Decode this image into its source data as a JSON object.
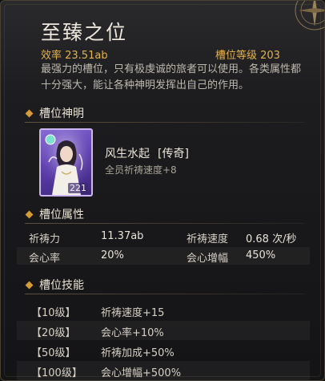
{
  "slot": {
    "title": "至臻之位",
    "efficiency": "效率 23.51ab",
    "level": "槽位等级 203",
    "description": "最强力的槽位，只有极虔诚的旅者可以使用。各类属性都十分强大，能让各种神明发挥出自己的作用。"
  },
  "deity_section": {
    "header": "槽位神明",
    "card_level": "221",
    "name": "风生水起",
    "rarity": "[传奇]",
    "effect": "全员祈祷速度+8"
  },
  "attr_section": {
    "header": "槽位属性",
    "rows": [
      {
        "left_label": "祈祷力",
        "left_value": "11.37ab",
        "right_label": "祈祷速度",
        "right_value": "0.68 次/秒"
      },
      {
        "left_label": "会心率",
        "left_value": "20%",
        "right_label": "会心增幅",
        "right_value": "450%"
      }
    ]
  },
  "skill_section": {
    "header": "槽位技能",
    "rows": [
      {
        "level": "【10级】",
        "effect": "祈祷速度+15"
      },
      {
        "level": "【20级】",
        "effect": "会心率+10%"
      },
      {
        "level": "【50级】",
        "effect": "祈祷加成+50%"
      },
      {
        "level": "【100级】",
        "effect": "会心增幅+500%"
      }
    ]
  },
  "colors": {
    "accent_gold": "#e3b24b",
    "legendary_purple": "#8a6fd8"
  },
  "icons": {
    "corner": "ornament-compass-icon",
    "section_bullet": "diamond-icon"
  }
}
